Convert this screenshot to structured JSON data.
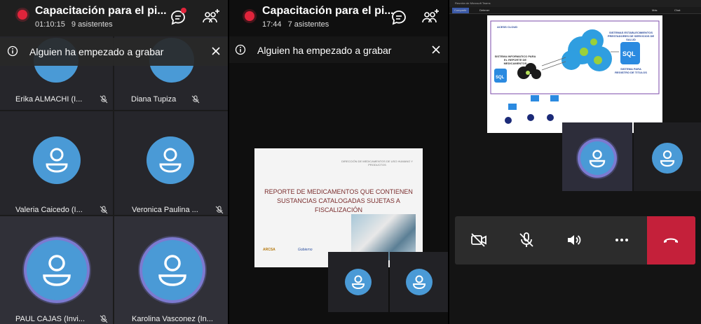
{
  "panel1": {
    "meeting_title": "Capacitación para el pi...",
    "duration": "01:10:15",
    "attendees": "9 asistentes",
    "banner": "Alguien ha empezado a grabar",
    "participants": [
      {
        "name": "Erika ALMACHI (I..."
      },
      {
        "name": "Diana  Tupiza"
      },
      {
        "name": "Valeria Caicedo (I..."
      },
      {
        "name": "Veronica Paulina ..."
      },
      {
        "name": "PAUL CAJAS (Invi..."
      },
      {
        "name": "Karolina Vasconez (In..."
      }
    ]
  },
  "panel2": {
    "meeting_title": "Capacitación para el pi...",
    "duration": "17:44",
    "attendees": "7 asistentes",
    "banner": "Alguien ha empezado a grabar",
    "slide": {
      "header": "DIRECCIÓN DE MEDICAMENTOS DE USO HUMANO Y PRODUCTOS",
      "title": "REPORTE DE MEDICAMENTOS QUE CONTIENEN SUSTANCIAS CATALOGADAS SUJETAS A FISCALIZACIÓN",
      "logo1": "ARCSA",
      "logo2": "Gobierno"
    }
  },
  "panel3": {
    "window_title": "Reunión de Microsoft Teams",
    "toolbar": [
      "Compartir",
      "Detener",
      "Más",
      "Chat"
    ],
    "diagram": {
      "cloud_label": "ACESS CLOUD",
      "left_text": "SISTEMA INFORMATICO PARA EL REPORTE DE MEDICAMENTOS",
      "right_text": "SISTEMA PARA REGISTRO DE TITULOS",
      "top_text": "SISTEMAS ESTABLECIMIENTOS PRESTADORES DE SERVICIOS DE SALUD",
      "sql": "SQL"
    }
  },
  "colors": {
    "record": "#e0243b",
    "avatar": "#4a9ad6",
    "ring": "#7c7ad0",
    "end_call": "#c4203a"
  }
}
